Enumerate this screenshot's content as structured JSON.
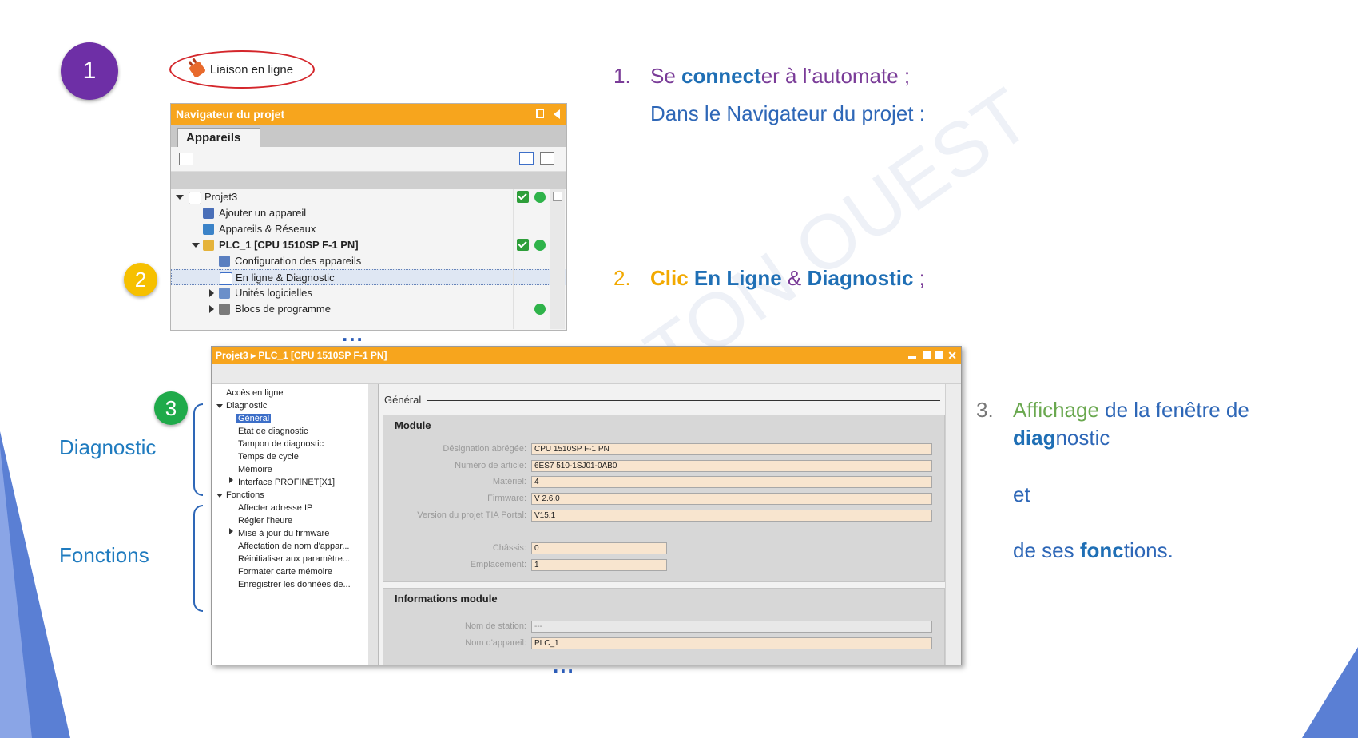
{
  "markers": {
    "one": "1",
    "two": "2",
    "three": "3"
  },
  "colors": {
    "marker_one": "#6e2fa6",
    "marker_two": "#f6c000",
    "marker_three": "#1faa4a",
    "orange_title": "#f7a51d",
    "accent_blue": "#2e67b7"
  },
  "watermark": "TON OUEST",
  "toolbar_button": {
    "label": "Liaison en ligne",
    "icon": "plug-icon"
  },
  "navigator": {
    "title": "Navigateur du projet",
    "tab": "Appareils",
    "tree": [
      {
        "label": "Projet3"
      },
      {
        "label": "Ajouter un appareil"
      },
      {
        "label": "Appareils & Réseaux"
      },
      {
        "label": "PLC_1 [CPU 1510SP F-1 PN]"
      },
      {
        "label": "Configuration des appareils"
      },
      {
        "label": "En ligne & Diagnostic"
      },
      {
        "label": "Unités logicielles"
      },
      {
        "label": "Blocs de programme"
      }
    ]
  },
  "ellipsis": "...",
  "diag_window": {
    "breadcrumb": "Projet3 ▸ PLC_1 [CPU 1510SP F-1 PN]",
    "left_items": [
      "Accès en ligne",
      "Diagnostic",
      "Général",
      "Etat de diagnostic",
      "Tampon de diagnostic",
      "Temps de cycle",
      "Mémoire",
      "Interface PROFINET[X1]",
      "Fonctions",
      "Affecter adresse IP",
      "Régler l'heure",
      "Mise à jour du firmware",
      "Affectation de nom d'appar...",
      "Réinitialiser aux paramètre...",
      "Formater carte mémoire",
      "Enregistrer les données de..."
    ],
    "general_title": "Général",
    "module_section": "Module",
    "fields": [
      {
        "label": "Désignation abrégée:",
        "value": "CPU 1510SP F-1 PN"
      },
      {
        "label": "Numéro de article:",
        "value": "6ES7 510-1SJ01-0AB0"
      },
      {
        "label": "Matériel:",
        "value": "4"
      },
      {
        "label": "Firmware:",
        "value": "V 2.6.0"
      },
      {
        "label": "Version du projet TIA Portal:",
        "value": "V15.1"
      },
      {
        "label": "Châssis:",
        "value": "0"
      },
      {
        "label": "Emplacement:",
        "value": "1"
      }
    ],
    "info_section": "Informations module",
    "info_fields": [
      {
        "label": "Nom de station:",
        "value": "---"
      },
      {
        "label": "Nom d'appareil:",
        "value": "PLC_1"
      }
    ]
  },
  "side_labels": {
    "diagnostic": "Diagnostic",
    "fonctions": "Fonctions"
  },
  "steps": {
    "s1_num": "1.",
    "s1_a": "Se ",
    "s1_b": "connect",
    "s1_c": "er à l’automate ;",
    "s1_line2": "Dans le Navigateur du projet :",
    "s2_num": "2.",
    "s2_a": "Clic ",
    "s2_b": "En Ligne",
    "s2_c": " & ",
    "s2_d": "Diagnostic",
    "s2_e": " ;",
    "s3_num": "3.",
    "s3_a": "Affichage",
    "s3_b": " de la fenêtre de",
    "s3_c": "diag",
    "s3_d": "nostic",
    "s3_et": "et",
    "s3_e": "de ses ",
    "s3_f": "fonc",
    "s3_g": "tions."
  }
}
